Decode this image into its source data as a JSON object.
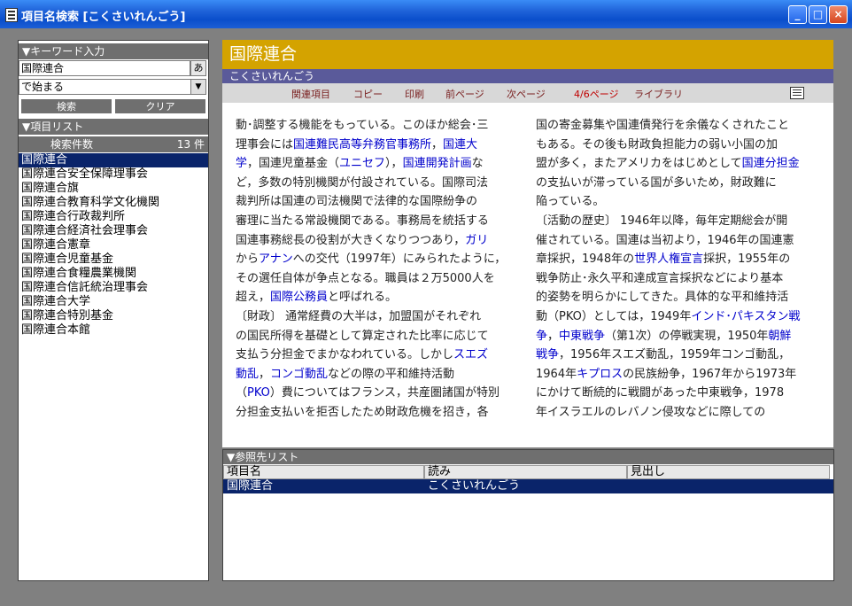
{
  "window": {
    "title": "項目名検索 [こくさいれんごう]",
    "controls": {
      "minimize": "_",
      "maximize": "□",
      "close": "×"
    }
  },
  "keyword": {
    "header": "▼キーワード入力",
    "value": "国際連合",
    "ime_label": "あ",
    "mode": "で始まる",
    "search_label": "検索",
    "clear_label": "クリア"
  },
  "item_list": {
    "header": "▼項目リスト",
    "count_label": "検索件数",
    "count_value": "13 件",
    "items": [
      "国際連合",
      "国際連合安全保障理事会",
      "国際連合旗",
      "国際連合教育科学文化機関",
      "国際連合行政裁判所",
      "国際連合経済社会理事会",
      "国際連合憲章",
      "国際連合児童基金",
      "国際連合食糧農業機関",
      "国際連合信託統治理事会",
      "国際連合大学",
      "国際連合特別基金",
      "国際連合本館"
    ],
    "selected_index": 0
  },
  "article": {
    "title": "国際連合",
    "reading": "こくさいれんごう",
    "toolbar": {
      "related": "関連項目",
      "copy": "コピー",
      "print": "印刷",
      "prev": "前ページ",
      "next": "次ページ",
      "page": "4/6ページ",
      "library": "ライブラリ"
    },
    "col1": [
      [
        [
          "t",
          "動･調整する機能をもっている。このほか総会･三"
        ]
      ],
      [
        [
          "t",
          "理事会には"
        ],
        [
          "l",
          "国連難民高等弁務官事務所"
        ],
        [
          "t",
          "，"
        ],
        [
          "l",
          "国連大"
        ]
      ],
      [
        [
          "l",
          "学"
        ],
        [
          "t",
          "，国連児童基金（"
        ],
        [
          "l",
          "ユニセフ"
        ],
        [
          "t",
          "），"
        ],
        [
          "l",
          "国連開発計画"
        ],
        [
          "t",
          "な"
        ]
      ],
      [
        [
          "t",
          "ど，多数の特別機関が付設されている。国際司法"
        ]
      ],
      [
        [
          "t",
          "裁判所は国連の司法機関で法律的な国際紛争の"
        ]
      ],
      [
        [
          "t",
          "審理に当たる常設機関である。事務局を統括する"
        ]
      ],
      [
        [
          "t",
          "国連事務総長の役割が大きくなりつつあり，"
        ],
        [
          "l",
          "ガリ"
        ]
      ],
      [
        [
          "t",
          "から"
        ],
        [
          "l",
          "アナン"
        ],
        [
          "t",
          "への交代（1997年）にみられたように，"
        ]
      ],
      [
        [
          "t",
          "その選任自体が争点となる。職員は２万5000人を"
        ]
      ],
      [
        [
          "t",
          "超え，"
        ],
        [
          "l",
          "国際公務員"
        ],
        [
          "t",
          "と呼ばれる。"
        ]
      ],
      [
        [
          "t",
          "〔財政〕 通常経費の大半は，加盟国がそれぞれ"
        ]
      ],
      [
        [
          "t",
          "の国民所得を基礎として算定された比率に応じて"
        ]
      ],
      [
        [
          "t",
          "支払う分担金でまかなわれている。しかし"
        ],
        [
          "l",
          "スエズ"
        ]
      ],
      [
        [
          "l",
          "動乱"
        ],
        [
          "t",
          "，"
        ],
        [
          "l",
          "コンゴ動乱"
        ],
        [
          "t",
          "などの際の平和維持活動"
        ]
      ],
      [
        [
          "t",
          "（"
        ],
        [
          "l",
          "PKO"
        ],
        [
          "t",
          "）費についてはフランス，共産圏諸国が特別"
        ]
      ],
      [
        [
          "t",
          "分担金支払いを拒否したため財政危機を招き，各"
        ]
      ]
    ],
    "col2": [
      [
        [
          "t",
          "国の寄金募集や国連債発行を余儀なくされたこと"
        ]
      ],
      [
        [
          "t",
          "もある。その後も財政負担能力の弱い小国の加"
        ]
      ],
      [
        [
          "t",
          "盟が多く，またアメリカをはじめとして"
        ],
        [
          "l",
          "国連分担金"
        ]
      ],
      [
        [
          "t",
          "の支払いが滞っている国が多いため，財政難に"
        ]
      ],
      [
        [
          "t",
          "陥っている。"
        ]
      ],
      [
        [
          "t",
          "〔活動の歴史〕 1946年以降，毎年定期総会が開"
        ]
      ],
      [
        [
          "t",
          "催されている。国連は当初より，1946年の国連憲"
        ]
      ],
      [
        [
          "t",
          "章採択，1948年の"
        ],
        [
          "l",
          "世界人権宣言"
        ],
        [
          "t",
          "採択，1955年の"
        ]
      ],
      [
        [
          "t",
          "戦争防止･永久平和達成宣言採択などにより基本"
        ]
      ],
      [
        [
          "t",
          "的姿勢を明らかにしてきた。具体的な平和維持活"
        ]
      ],
      [
        [
          "t",
          "動（PKO）としては，1949年"
        ],
        [
          "l",
          "インド･パキスタン戦"
        ]
      ],
      [
        [
          "l",
          "争"
        ],
        [
          "t",
          "，"
        ],
        [
          "l",
          "中東戦争"
        ],
        [
          "t",
          "（第1次）の停戦実現，1950年"
        ],
        [
          "l",
          "朝鮮"
        ]
      ],
      [
        [
          "l",
          "戦争"
        ],
        [
          "t",
          "，1956年スエズ動乱，1959年コンゴ動乱，"
        ]
      ],
      [
        [
          "t",
          "1964年"
        ],
        [
          "l",
          "キプロス"
        ],
        [
          "t",
          "の民族紛争，1967年から1973年"
        ]
      ],
      [
        [
          "t",
          "にかけて断続的に戦闘があった中東戦争，1978"
        ]
      ],
      [
        [
          "t",
          "年イスラエルのレバノン侵攻などに際しての"
        ]
      ]
    ]
  },
  "reference": {
    "header": "▼参照先リスト",
    "columns": [
      "項目名",
      "読み",
      "見出し"
    ],
    "rows": [
      [
        "国際連合",
        "こくさいれんごう",
        ""
      ]
    ]
  },
  "colors": {
    "title_bar": "#0a4ecb",
    "article_title_bg": "#d4a300",
    "reading_bg": "#5a5a9a",
    "selection": "#0a246a",
    "link": "#0000cc"
  }
}
